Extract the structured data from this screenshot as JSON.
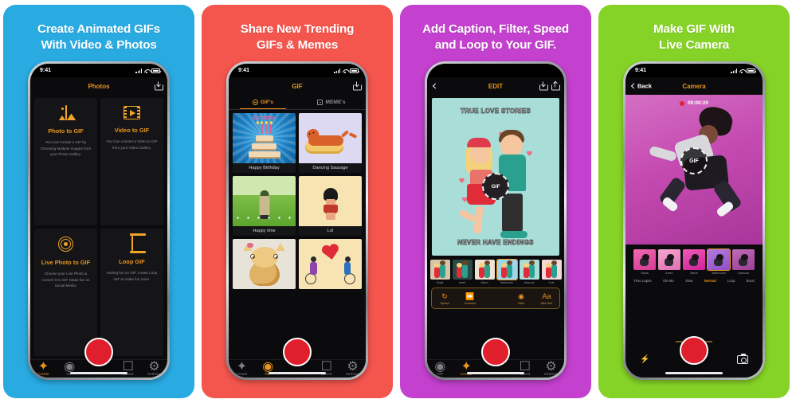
{
  "app": {
    "status_time": "9:41",
    "gif_badge": "GIF",
    "record_label": "record-button"
  },
  "panels": [
    {
      "id": "panel-photos",
      "bg": "#29ABE2",
      "title_lines": [
        "Create Animated GIFs",
        "With Video & Photos"
      ],
      "nav_title": "Photos",
      "cards": [
        {
          "icon": "photo-icon",
          "title": "Photo to GIF",
          "desc": "You Can Create a GIF by Choosing Multiple Images from your Photo Gallery."
        },
        {
          "icon": "video-icon",
          "title": "Video to GIF",
          "desc": "You Can convert a Video to GIF from your Video Gallery."
        },
        {
          "icon": "live-photo-icon",
          "title": "Live Photo to GIF",
          "desc": "Choose your Live Photo & convert it to GIF. Make fun on Social Media."
        },
        {
          "icon": "loop-icon",
          "title": "Loop GIF",
          "desc": "Having fun on GIF, create Loop GIF to make fun more."
        }
      ],
      "tabs": [
        {
          "label": "Create",
          "icon": "star-icon",
          "active": true
        },
        {
          "label": "GIF",
          "icon": "gif-icon",
          "active": false
        },
        {
          "label": "Saved",
          "icon": "saved-icon",
          "active": false
        },
        {
          "label": "Settings",
          "icon": "gear-icon",
          "active": false
        }
      ]
    },
    {
      "id": "panel-trending",
      "bg": "#F4564E",
      "title_lines": [
        "Share New Trending",
        "GIFs & Memes"
      ],
      "nav_title": "GIF",
      "segments": [
        {
          "label": "GIF's",
          "active": true
        },
        {
          "label": "MEME's",
          "active": false
        }
      ],
      "items": [
        {
          "caption": "Happy Birthday",
          "art": "cake"
        },
        {
          "caption": "Dancing Sausage",
          "art": "sausage"
        },
        {
          "caption": "Happy time",
          "art": "field"
        },
        {
          "caption": "Lol",
          "art": "lol"
        },
        {
          "caption": "",
          "art": "cat"
        },
        {
          "caption": "",
          "art": "bike"
        }
      ],
      "tabs": [
        {
          "label": "Create",
          "icon": "star-icon",
          "active": false
        },
        {
          "label": "GIF",
          "icon": "gif-icon",
          "active": true
        },
        {
          "label": "Saved",
          "icon": "saved-icon",
          "active": false
        },
        {
          "label": "Settings",
          "icon": "gear-icon",
          "active": false
        }
      ]
    },
    {
      "id": "panel-edit",
      "bg": "#C341CE",
      "title_lines": [
        "Add Caption, Filter, Speed",
        "and Loop to Your GIF."
      ],
      "nav_title": "EDIT",
      "caption_top": "TRUE LOVE STORIES",
      "caption_bottom": "NEVER HAVE ENDINGS",
      "filters": [
        {
          "label": "Sepia",
          "selected": false
        },
        {
          "label": "Invert",
          "selected": false
        },
        {
          "label": "Warm",
          "selected": false
        },
        {
          "label": "Watercolor",
          "selected": true
        },
        {
          "label": "charcoal",
          "selected": false
        },
        {
          "label": "Cute",
          "selected": false
        }
      ],
      "edit_tools": [
        {
          "label": "Speed",
          "icon": "speed-icon"
        },
        {
          "label": "Forward",
          "icon": "forward-icon"
        },
        {
          "label": "Filter",
          "icon": "filter-icon"
        },
        {
          "label": "Add Text",
          "icon": "add-text-icon"
        }
      ],
      "tabs": [
        {
          "label": "GIF",
          "icon": "gif-icon",
          "active": false
        },
        {
          "label": "Create",
          "icon": "star-icon",
          "active": true
        },
        {
          "label": "Saved",
          "icon": "saved-icon",
          "active": false
        },
        {
          "label": "Settings",
          "icon": "gear-icon",
          "active": false
        }
      ]
    },
    {
      "id": "panel-camera",
      "bg": "#86D327",
      "title_lines": [
        "Make GIF With",
        "Live Camera"
      ],
      "nav_back": "Back",
      "nav_title": "Camera",
      "timer": "00:00:20",
      "filters": [
        {
          "label": "Sepia",
          "selected": false
        },
        {
          "label": "Invert",
          "selected": false
        },
        {
          "label": "Warm",
          "selected": false
        },
        {
          "label": "Watercolor",
          "selected": true
        },
        {
          "label": "charcoal",
          "selected": false
        }
      ],
      "modes": [
        {
          "label": "Time Lapse",
          "active": false
        },
        {
          "label": "Slo-Mo",
          "active": false
        },
        {
          "label": "Slow",
          "active": false
        },
        {
          "label": "Normal",
          "active": true
        },
        {
          "label": "Loop",
          "active": false
        },
        {
          "label": "Brust",
          "active": false
        }
      ],
      "bottom_icons": [
        {
          "name": "flash-icon"
        },
        {
          "name": "camera-flip-icon"
        }
      ]
    }
  ]
}
